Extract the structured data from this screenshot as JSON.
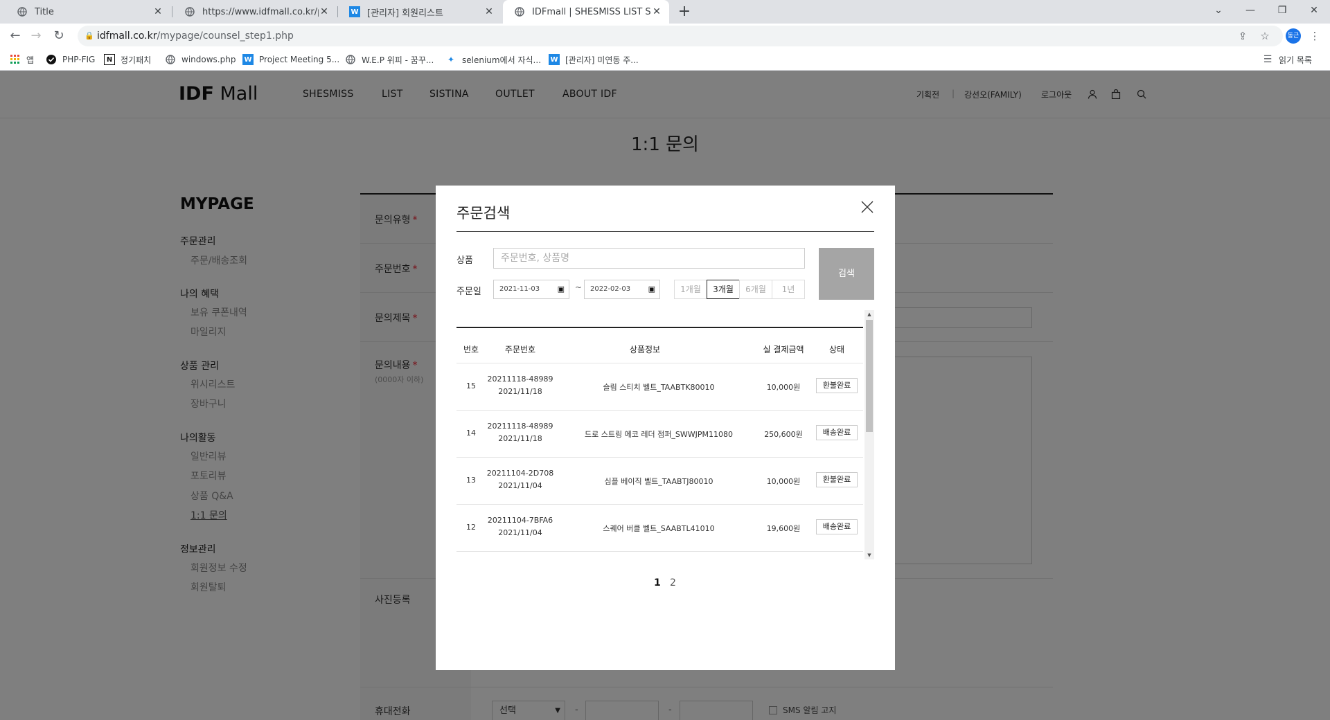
{
  "browser": {
    "tabs": [
      {
        "title": "Title"
      },
      {
        "title": "https://www.idfmall.co.kr/patch_"
      },
      {
        "title": "[관리자] 회원리스트"
      },
      {
        "title": "IDFmall | SHESMISS LIST SISTIN"
      }
    ],
    "url_host": "idfmall.co.kr",
    "url_path": "/mypage/counsel_step1.php",
    "profile_initial": "동근",
    "bookmarks": [
      {
        "label": "앱"
      },
      {
        "label": "PHP-FIG"
      },
      {
        "label": "정기패치"
      },
      {
        "label": "windows.php"
      },
      {
        "label": "Project Meeting 5..."
      },
      {
        "label": "W.E.P 위피 - 꿈꾸..."
      },
      {
        "label": "selenium에서 자식..."
      },
      {
        "label": "[관리자] 미연동 주..."
      }
    ],
    "reading_list": "읽기 목록"
  },
  "site": {
    "logo_bold": "IDF",
    "logo_rest": " Mall",
    "nav": [
      "SHESMISS",
      "LIST",
      "SISTINA",
      "OUTLET",
      "ABOUT IDF"
    ],
    "util": {
      "event": "기획전",
      "sep": "|",
      "user": "강선오(FAMILY)",
      "logout": "로그아웃"
    }
  },
  "page_title": "1:1 문의",
  "sidebar": {
    "title": "MYPAGE",
    "groups": [
      {
        "label": "주문관리",
        "items": [
          "주문/배송조회"
        ]
      },
      {
        "label": "나의 혜택",
        "items": [
          "보유 쿠폰내역",
          "마일리지"
        ]
      },
      {
        "label": "상품 관리",
        "items": [
          "위시리스트",
          "장바구니"
        ]
      },
      {
        "label": "나의활동",
        "items": [
          "일반리뷰",
          "포토리뷰",
          "상품 Q&A",
          "1:1 문의"
        ]
      },
      {
        "label": "정보관리",
        "items": [
          "회원정보 수정",
          "회원탈퇴"
        ]
      }
    ]
  },
  "form": {
    "labels": [
      "문의유형",
      "주문번호",
      "문의제목",
      "문의내용",
      "사진등록",
      "휴대전화"
    ],
    "content_hint": "(0000자 이하)",
    "phone_select": "선택",
    "dash": "-",
    "sms_label": "SMS 알림 고지"
  },
  "modal": {
    "title": "주문검색",
    "product_label": "상품",
    "product_placeholder": "주문번호, 상품명",
    "date_label": "주문일",
    "date_from": "2021-11-03",
    "date_to": "2022-02-03",
    "tilde": "~",
    "periods": [
      "1개월",
      "3개월",
      "6개월",
      "1년"
    ],
    "active_period": "3개월",
    "search_button": "검색",
    "table": {
      "headers": [
        "번호",
        "주문번호",
        "상품정보",
        "실 결제금액",
        "상태"
      ],
      "rows": [
        {
          "no": "15",
          "order_no": "20211118-48989",
          "date": "2021/11/18",
          "product": "슬림 스티치 벨트_TAABTK80010",
          "amount": "10,000원",
          "status": "환불완료"
        },
        {
          "no": "14",
          "order_no": "20211118-48989",
          "date": "2021/11/18",
          "product": "드로 스트링 에코 레더 점퍼_SWWJPM11080",
          "amount": "250,600원",
          "status": "배송완료"
        },
        {
          "no": "13",
          "order_no": "20211104-2D708",
          "date": "2021/11/04",
          "product": "심플 베이직 벨트_TAABTJ80010",
          "amount": "10,000원",
          "status": "환불완료"
        },
        {
          "no": "12",
          "order_no": "20211104-7BFA6",
          "date": "2021/11/04",
          "product": "스퀘어 버클 벨트_SAABTL41010",
          "amount": "19,600원",
          "status": "배송완료"
        }
      ]
    },
    "pagination": [
      "1",
      "2"
    ],
    "current_page": "1"
  },
  "colors": {
    "overlay": "#000000",
    "search_button": "#a5a5a5",
    "required": "#e23333",
    "avatar": "#1a73e8"
  }
}
